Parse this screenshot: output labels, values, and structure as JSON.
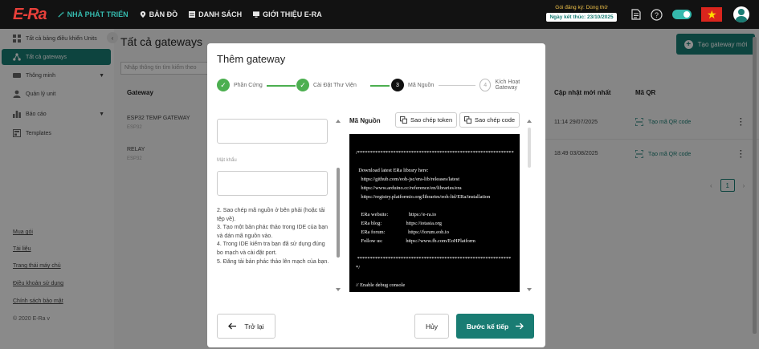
{
  "app": {
    "logo": "E-Ra",
    "nav": [
      {
        "label": "NHÀ PHÁT TRIỂN"
      },
      {
        "label": "BẢN ĐỒ"
      },
      {
        "label": "DANH SÁCH"
      },
      {
        "label": "GIỚI THIỆU E-RA"
      }
    ],
    "plan_title": "Gói đăng ký: Dùng thử",
    "plan_end": "Ngày kết thúc: 23/10/2025"
  },
  "sidebar": {
    "items": [
      {
        "label": "Tất cả bảng điều khiển Units"
      },
      {
        "label": "Tất cả gateways"
      },
      {
        "label": "Thông minh"
      },
      {
        "label": "Quản lý unit"
      },
      {
        "label": "Báo cáo"
      },
      {
        "label": "Templates"
      }
    ],
    "links": [
      "Mua gói",
      "Tài liệu",
      "Trang thái máy chủ",
      "Điều khoản sử dụng",
      "Chính sách bảo mật"
    ],
    "copyright": "© 2020 E-Ra v"
  },
  "main": {
    "title": "Tất cả gateways",
    "create_button": "Tạo gateway mới",
    "search_placeholder": "Nhập thông tin tìm kiếm theo",
    "columns": {
      "gateway": "Gateway",
      "updated": "Cập nhật mới nhất",
      "qr": "Mã QR"
    },
    "rows": [
      {
        "name": "ESP32 TEMP GATEWAY",
        "sub": "ESP32",
        "updated": "11:14 29/07/2025",
        "qr": "Tạo mã QR code"
      },
      {
        "name": "RELAY",
        "sub": "ESP32",
        "updated": "18:49 03/08/2025",
        "qr": "Tạo mã QR code"
      }
    ],
    "page": "1"
  },
  "modal": {
    "title": "Thêm gateway",
    "steps": [
      {
        "num": "✓",
        "label": "Phần Cứng"
      },
      {
        "num": "✓",
        "label": "Cài Đặt Thư Viện"
      },
      {
        "num": "3",
        "label": "Mã Nguồn"
      },
      {
        "num": "4",
        "label": "Kích Hoạt Gateway"
      }
    ],
    "password_label": "Mật khẩu",
    "instructions": "2. Sao chép mã nguồn ở bên phải (hoặc tải tệp về).\n3. Tạo một bản phác thảo trong IDE của bạn và dán mã nguồn vào.\n4. Trong IDE kiểm tra bạn đã sử dụng đúng bo mạch và cài đặt port.\n5. Đăng tải bản phác thảo lên mạch của bạn.",
    "code_label": "Mã Nguồn",
    "copy_token": "Sao chép token",
    "copy_code": "Sao chép code",
    "code": "/*************************************************************\n\n  Download latest ERa library here:\n    https://github.com/eoh-jsc/era-lib/releases/latest\n    https://www.arduino.cc/reference/en/libraries/era\n    https://registry.platformio.org/libraries/eoh-ltd/ERa/installation\n\n    ERa website:                https://e-ra.io\n    ERa blog:                   https://iotasia.org\n    ERa forum:                  https://forum.eoh.io\n    Follow us:                  https://www.fb.com/EoHPlatform\n\n *************************************************************/\n\n// Enable debug console",
    "back": "Trở lại",
    "cancel": "Hủy",
    "next": "Bước kế tiếp"
  }
}
